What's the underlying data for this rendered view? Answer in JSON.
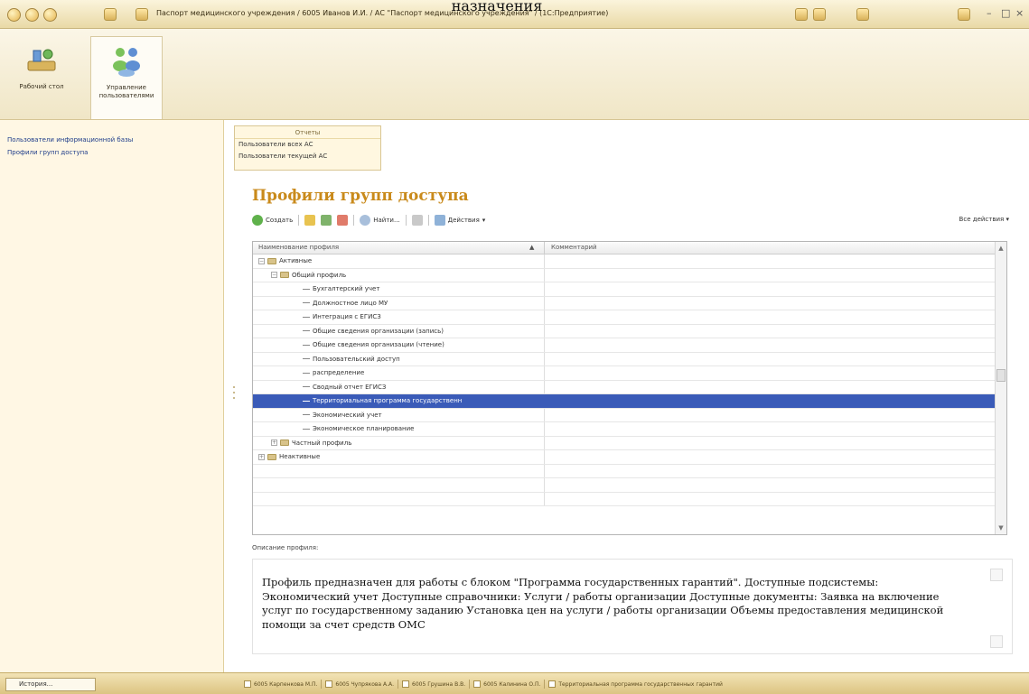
{
  "window": {
    "title": "Паспорт медицинского учреждения / 6005 Иванов И.И. / АС \"Паспорт медицинского учреждения\" / (1С:Предприятие)",
    "controls": {
      "minimize": "–",
      "restore": "□",
      "close": "×"
    },
    "header_fragment": "назначения"
  },
  "ribbon": {
    "items": [
      {
        "label": "Рабочий стол",
        "icon": "desktop-icon"
      },
      {
        "label": "Управление пользователями",
        "icon": "users-icon"
      }
    ]
  },
  "left_panel": {
    "links": [
      "Пользователи информационной базы",
      "Профили групп доступа"
    ]
  },
  "reports": {
    "title": "Отчеты",
    "links": [
      "Пользователи всех АС",
      "Пользователи текущей АС"
    ]
  },
  "form": {
    "title": "Профили групп доступа",
    "toolbar": {
      "create": "Создать",
      "find": "Найти...",
      "actions": "Действия",
      "all_actions": "Все действия"
    },
    "table": {
      "columns": [
        "Наименование профиля",
        "Комментарий"
      ],
      "rows": [
        {
          "label": "Активные",
          "kind": "folder",
          "level": 0,
          "expander": "−"
        },
        {
          "label": "Общий профиль",
          "kind": "folder",
          "level": 1,
          "expander": "−"
        },
        {
          "label": "Бухгалтерский учет",
          "kind": "item",
          "level": 2
        },
        {
          "label": "Должностное лицо МУ",
          "kind": "item",
          "level": 2
        },
        {
          "label": "Интеграция с ЕГИСЗ",
          "kind": "item",
          "level": 2
        },
        {
          "label": "Общие сведения организации (запись)",
          "kind": "item",
          "level": 2
        },
        {
          "label": "Общие сведения организации (чтение)",
          "kind": "item",
          "level": 2
        },
        {
          "label": "Пользовательский доступ",
          "kind": "item",
          "level": 2
        },
        {
          "label": "распределение",
          "kind": "item",
          "level": 2
        },
        {
          "label": "Сводный отчет ЕГИСЗ",
          "kind": "item",
          "level": 2
        },
        {
          "label": "Территориальная программа государственн",
          "kind": "item",
          "level": 2,
          "selected": true
        },
        {
          "label": "Экономический учет",
          "kind": "item",
          "level": 2
        },
        {
          "label": "Экономическое планирование",
          "kind": "item",
          "level": 2
        },
        {
          "label": "Частный профиль",
          "kind": "folder",
          "level": 1,
          "expander": "+"
        },
        {
          "label": "Неактивные",
          "kind": "folder",
          "level": 0,
          "expander": "+"
        }
      ]
    },
    "description_label": "Описание профиля:",
    "description": "Профиль предназначен для работы с блоком \"Программа государственных гарантий\". Доступные подсистемы: Экономический учет Доступные справочники: Услуги / работы организации Доступные документы: Заявка на включение услуг по государственному заданию Установка цен на услуги / работы организации Объемы предоставления медицинской помощи за счет средств ОМС"
  },
  "status_bar": {
    "history": "История...",
    "open_windows": [
      "6005 Карпенкова М.П.",
      "6005 Чупрякова А.А.",
      "6005 Грушина В.В.",
      "6005 Калинина О.П.",
      "Территориальная программа государственных гарантий"
    ]
  },
  "colors": {
    "accent_title": "#c98a1b",
    "selection": "#3a5bb8",
    "link": "#1f3d8a"
  }
}
